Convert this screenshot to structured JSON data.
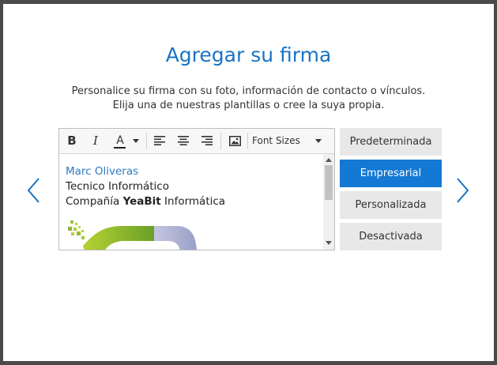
{
  "dialog": {
    "title": "Agregar su firma",
    "subtitle_line1": "Personalice su firma con su foto, información de contacto o vínculos.",
    "subtitle_line2": "Elija una de nuestras plantillas o cree la suya propia."
  },
  "toolbar": {
    "bold": "B",
    "italic": "I",
    "font_color": "A",
    "font_sizes": "Font Sizes"
  },
  "signature": {
    "name": "Marc Oliveras",
    "job": "Tecnico Informático",
    "company_prefix": "Compañía ",
    "company_bold": "YeaBit",
    "company_suffix": " Informática"
  },
  "templates": [
    {
      "label": "Predeterminada",
      "active": false
    },
    {
      "label": "Empresarial",
      "active": true
    },
    {
      "label": "Personalizada",
      "active": false
    },
    {
      "label": "Desactivada",
      "active": false
    }
  ],
  "colors": {
    "accent": "#1479d4",
    "title": "#1a73c4",
    "link": "#2f7ac0"
  }
}
